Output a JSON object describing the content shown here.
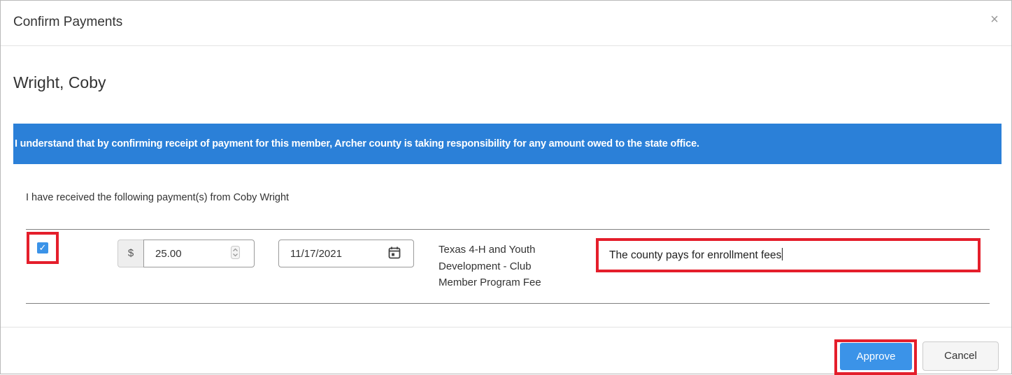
{
  "dialog": {
    "title": "Confirm Payments",
    "close_label": "×"
  },
  "member": {
    "name": "Wright, Coby"
  },
  "notice": {
    "text": "I understand that by confirming receipt of payment for this member, Archer county is taking responsibility for any amount owed to the state office.",
    "background_color": "#2b80d8"
  },
  "payments": {
    "intro": "I have received the following payment(s) from Coby Wright",
    "rows": [
      {
        "checked": true,
        "currency_symbol": "$",
        "amount": "25.00",
        "date": "11/17/2021",
        "description": "Texas 4-H and Youth Development - Club Member Program Fee",
        "notes": "The county pays for enrollment fees"
      }
    ]
  },
  "footer": {
    "approve_label": "Approve",
    "cancel_label": "Cancel"
  },
  "colors": {
    "highlight": "#e41e2b",
    "primary_button": "#3b93e8"
  },
  "icons": {
    "check": "check-icon",
    "spinner": "spinner-arrows-icon",
    "calendar": "calendar-icon",
    "close": "close-icon"
  }
}
